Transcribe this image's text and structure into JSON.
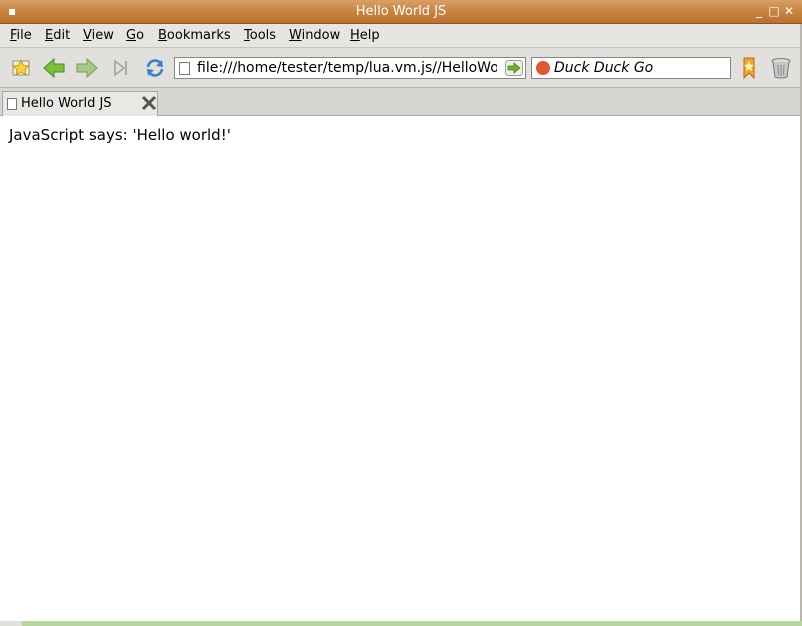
{
  "window": {
    "title": "Hello World JS",
    "menu_glyph": "▪",
    "minimize_glyph": "_",
    "maximize_glyph": "□",
    "close_glyph": "✕"
  },
  "menubar": {
    "items": [
      {
        "key": "F",
        "rest": "ile"
      },
      {
        "key": "E",
        "rest": "dit"
      },
      {
        "key": "V",
        "rest": "iew"
      },
      {
        "key": "G",
        "rest": "o"
      },
      {
        "key": "B",
        "rest": "ookmarks"
      },
      {
        "key": "T",
        "rest": "ools"
      },
      {
        "key": "W",
        "rest": "indow"
      },
      {
        "key": "H",
        "rest": "elp"
      }
    ]
  },
  "toolbar": {
    "icons": [
      "home-star-icon",
      "back-arrow-icon",
      "forward-arrow-icon",
      "stop-icon",
      "reload-icon"
    ],
    "url": "file:///home/tester/temp/lua.vm.js//HelloWorldJS.html",
    "search_engine": "Duck Duck Go",
    "accent_colors": {
      "back": "#6fb22e",
      "forward": "#9fbf6a",
      "reload": "#3d7fc4",
      "ddg": "#de5833",
      "bookmark": "#f2a23a"
    }
  },
  "tabs": [
    {
      "label": "Hello World JS"
    }
  ],
  "page": {
    "text": "JavaScript says: 'Hello world!'"
  }
}
